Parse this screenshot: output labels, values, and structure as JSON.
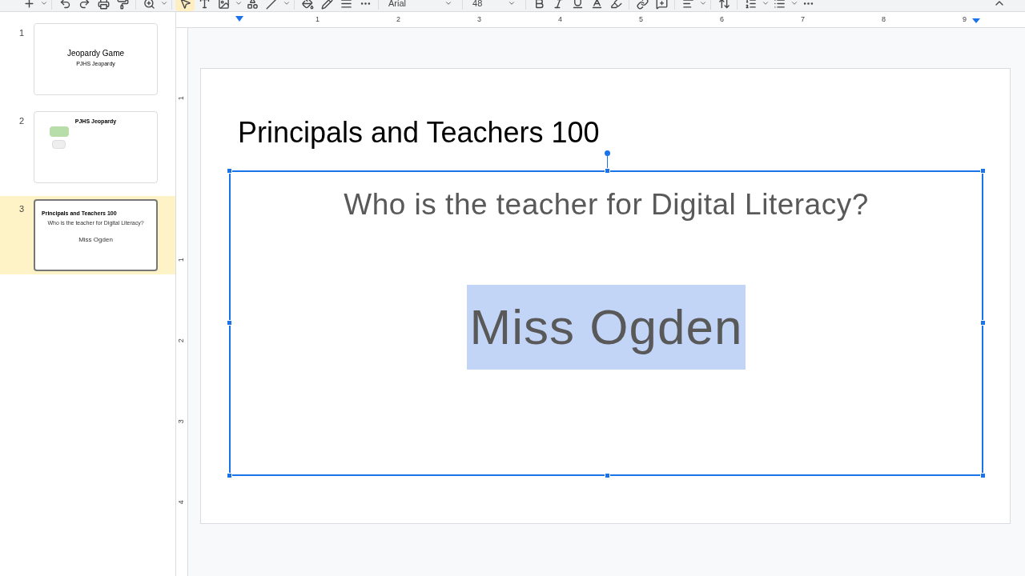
{
  "toolbar": {
    "font": "Arial",
    "font_size": "48"
  },
  "slides": [
    {
      "number": "1",
      "kind": "title",
      "title": "Jeopardy Game",
      "subtitle": "PJHS Jeopardy",
      "selected": false
    },
    {
      "number": "2",
      "kind": "board",
      "title": "PJHS Jeopardy",
      "selected": false
    },
    {
      "number": "3",
      "kind": "question",
      "title": "Principals and Teachers 100",
      "question": "Who is the teacher for Digital Literacy?",
      "answer": "Miss Ogden",
      "selected": true
    }
  ],
  "ruler": {
    "horizontal": [
      "1",
      "2",
      "3",
      "4",
      "5",
      "6",
      "7",
      "8",
      "9"
    ],
    "vertical": [
      "1",
      "1",
      "2",
      "3",
      "4"
    ]
  },
  "slide": {
    "title": "Principals and Teachers 100",
    "question": "Who is the teacher for Digital Literacy?",
    "answer": "Miss Ogden",
    "answer_selected": true
  }
}
